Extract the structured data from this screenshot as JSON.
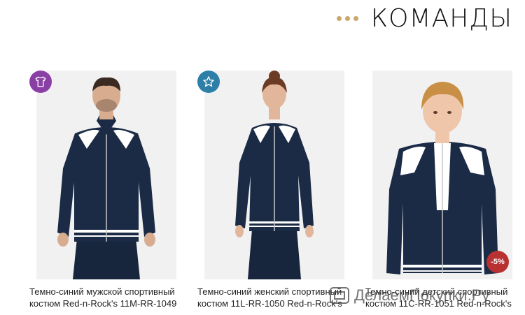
{
  "section": {
    "title": "КОМАНДЫ"
  },
  "products": [
    {
      "caption_line1": "Темно-синий мужской спортивный",
      "caption_line2": "костюм Red-n-Rock's 11M-RR-1049",
      "badge_icon": "t-shirt-icon"
    },
    {
      "caption_line1": "Темно-синий женский спортивный",
      "caption_line2": "костюм 11L-RR-1050 Red-n-Rock's",
      "badge_icon": "star-icon"
    },
    {
      "caption_line1": "Темно-синий детский спортивный",
      "caption_line2": "костюм 11C-RR-1051 Red-n-Rock's",
      "discount": "-5%"
    }
  ],
  "watermark": {
    "text": "ДелаемПокупки.Ру"
  },
  "colors": {
    "accent_gold": "#c9a86a",
    "navy": "#17253d",
    "badge_purple": "#8a3fa5",
    "badge_teal": "#2e7fa8",
    "sale_red": "#b93232"
  }
}
